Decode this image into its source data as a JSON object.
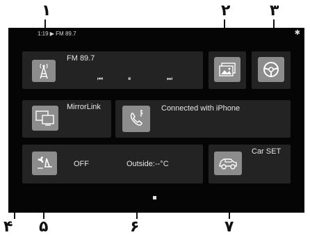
{
  "callouts": [
    "۱",
    "۲",
    "۳",
    "۴",
    "۵",
    "۶",
    "۷"
  ],
  "status_bar": {
    "text": "1:19 ▶ FM 89.7",
    "bluetooth_glyph": "✱"
  },
  "radio": {
    "station": "FM 89.7",
    "controls": {
      "prev": "⏮",
      "pause": "⏸",
      "next": "⏭"
    }
  },
  "mirrorlink": {
    "label": "MirrorLink"
  },
  "phone": {
    "label": "Connected with iPhone"
  },
  "climate": {
    "status": "OFF",
    "outside": "Outside:--°C"
  },
  "car_settings": {
    "label": "Car SET"
  },
  "icons": [
    "radio-tower-icon",
    "gallery-icon",
    "steering-wheel-icon",
    "monitor-icon",
    "phone-icon",
    "fan-seat-icon",
    "car-icon",
    "bluetooth-icon"
  ],
  "colors": {
    "screen": "#050505",
    "tile": "#232323",
    "icon_bg": "#8c8c8c",
    "text": "#e6e6e6"
  }
}
